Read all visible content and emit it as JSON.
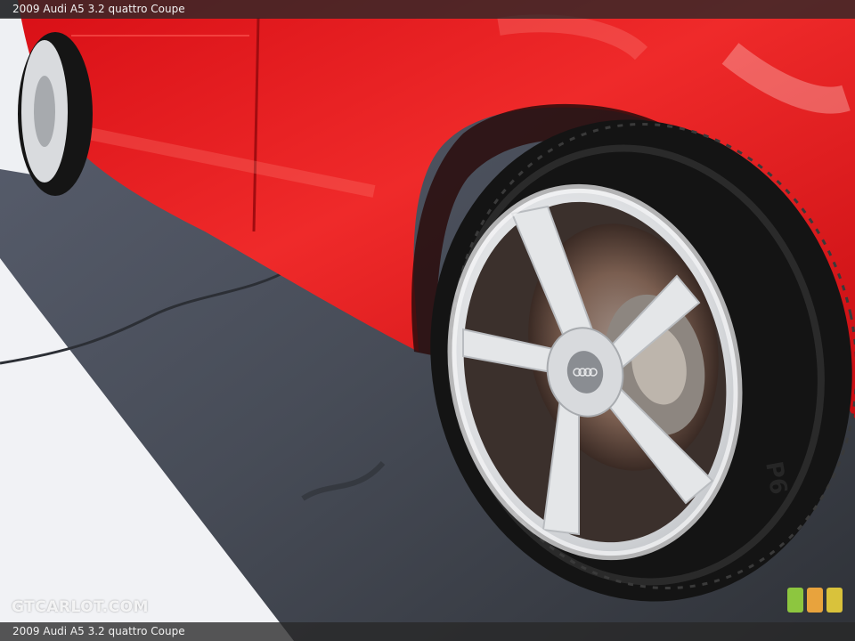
{
  "header": {
    "title": "2009 Audi A5 3.2 quattro Coupe"
  },
  "footer": {
    "caption": "2009 Audi A5 3.2 quattro Coupe"
  },
  "watermark": {
    "text": "GTCARLOT.COM"
  },
  "badge": {
    "colors": [
      "#8dc63f",
      "#e8a33d",
      "#d9c23b"
    ]
  },
  "colors": {
    "body_paint": "#e3191f",
    "tire": "#141414",
    "rim": "#e2e4e6",
    "asphalt": "#4a4f5a",
    "painted_line": "#f2f3f6"
  }
}
